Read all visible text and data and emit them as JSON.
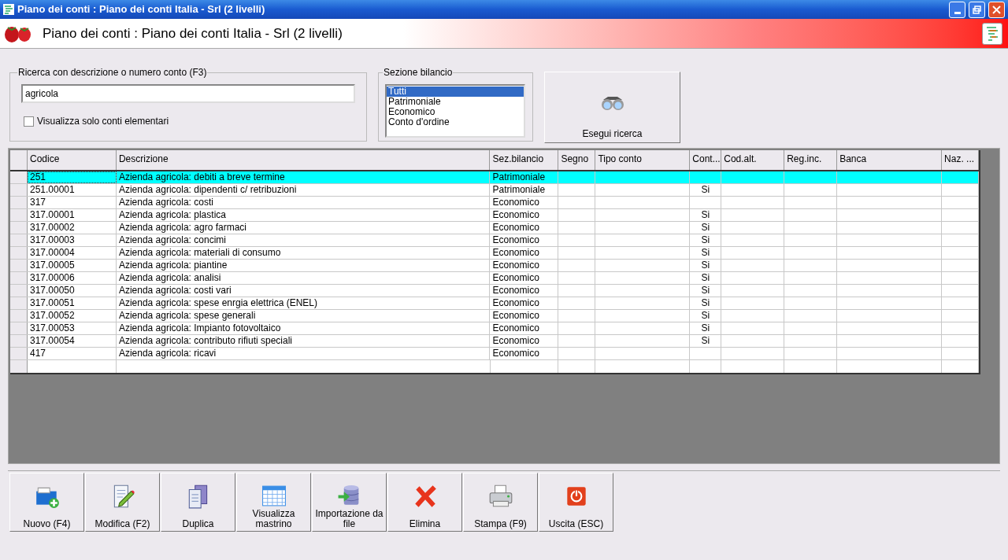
{
  "window": {
    "title": "Piano dei conti : Piano dei conti Italia - Srl (2 livelli)"
  },
  "header": {
    "title": "Piano dei conti : Piano dei conti Italia - Srl (2 livelli)"
  },
  "search": {
    "legend": "Ricerca con descrizione o numero conto (F3)",
    "value": "agricola",
    "checkbox": {
      "label": "Visualizza solo conti elementari",
      "checked": false
    }
  },
  "section_filter": {
    "legend": "Sezione bilancio",
    "options": [
      {
        "label": "Tutti",
        "selected": true
      },
      {
        "label": "Patrimoniale",
        "selected": false
      },
      {
        "label": "Economico",
        "selected": false
      },
      {
        "label": "Conto d'ordine",
        "selected": false
      }
    ]
  },
  "search_button": {
    "label": "Esegui ricerca"
  },
  "table": {
    "columns": [
      "Codice",
      "Descrizione",
      "Sez.bilancio",
      "Segno",
      "Tipo conto",
      "Cont...",
      "Cod.alt.",
      "Reg.inc.",
      "Banca",
      "Naz. ..."
    ],
    "rows": [
      {
        "selected": true,
        "cells": [
          "251",
          "Azienda agricola: debiti a breve termine",
          "Patrimoniale",
          "",
          "",
          "",
          "",
          "",
          "",
          ""
        ]
      },
      {
        "selected": false,
        "cells": [
          "251.00001",
          "Azienda agricola: dipendenti c/ retribuzioni",
          "Patrimoniale",
          "",
          "",
          "Si",
          "",
          "",
          "",
          ""
        ]
      },
      {
        "selected": false,
        "cells": [
          "317",
          "Azienda agricola: costi",
          "Economico",
          "",
          "",
          "",
          "",
          "",
          "",
          ""
        ]
      },
      {
        "selected": false,
        "cells": [
          "317.00001",
          "Azienda agricola: plastica",
          "Economico",
          "",
          "",
          "Si",
          "",
          "",
          "",
          ""
        ]
      },
      {
        "selected": false,
        "cells": [
          "317.00002",
          "Azienda agricola: agro farmaci",
          "Economico",
          "",
          "",
          "Si",
          "",
          "",
          "",
          ""
        ]
      },
      {
        "selected": false,
        "cells": [
          "317.00003",
          "Azienda agricola: concimi",
          "Economico",
          "",
          "",
          "Si",
          "",
          "",
          "",
          ""
        ]
      },
      {
        "selected": false,
        "cells": [
          "317.00004",
          "Azienda agricola: materiali di consumo",
          "Economico",
          "",
          "",
          "Si",
          "",
          "",
          "",
          ""
        ]
      },
      {
        "selected": false,
        "cells": [
          "317.00005",
          "Azienda agricola: piantine",
          "Economico",
          "",
          "",
          "Si",
          "",
          "",
          "",
          ""
        ]
      },
      {
        "selected": false,
        "cells": [
          "317.00006",
          "Azienda agricola: analisi",
          "Economico",
          "",
          "",
          "Si",
          "",
          "",
          "",
          ""
        ]
      },
      {
        "selected": false,
        "cells": [
          "317.00050",
          "Azienda agricola: costi vari",
          "Economico",
          "",
          "",
          "Si",
          "",
          "",
          "",
          ""
        ]
      },
      {
        "selected": false,
        "cells": [
          "317.00051",
          "Azienda agricola: spese enrgia elettrica (ENEL)",
          "Economico",
          "",
          "",
          "Si",
          "",
          "",
          "",
          ""
        ]
      },
      {
        "selected": false,
        "cells": [
          "317.00052",
          "Azienda agricola: spese generali",
          "Economico",
          "",
          "",
          "Si",
          "",
          "",
          "",
          ""
        ]
      },
      {
        "selected": false,
        "cells": [
          "317.00053",
          "Azienda agricola: Impianto fotovoltaico",
          "Economico",
          "",
          "",
          "Si",
          "",
          "",
          "",
          ""
        ]
      },
      {
        "selected": false,
        "cells": [
          "317.00054",
          "Azienda agricola: contributo rifiuti speciali",
          "Economico",
          "",
          "",
          "Si",
          "",
          "",
          "",
          ""
        ]
      },
      {
        "selected": false,
        "cells": [
          "417",
          "Azienda agricola: ricavi",
          "Economico",
          "",
          "",
          "",
          "",
          "",
          "",
          ""
        ]
      }
    ]
  },
  "toolbar": [
    {
      "kind": "new",
      "label": "Nuovo (F4)"
    },
    {
      "kind": "edit",
      "label": "Modifica (F2)"
    },
    {
      "kind": "duplicate",
      "label": "Duplica"
    },
    {
      "kind": "ledger",
      "label": "Visualizza mastrino"
    },
    {
      "kind": "import",
      "label": "Importazione da file"
    },
    {
      "kind": "delete",
      "label": "Elimina"
    },
    {
      "kind": "print",
      "label": "Stampa (F9)"
    },
    {
      "kind": "exit",
      "label": "Uscita (ESC)"
    }
  ]
}
